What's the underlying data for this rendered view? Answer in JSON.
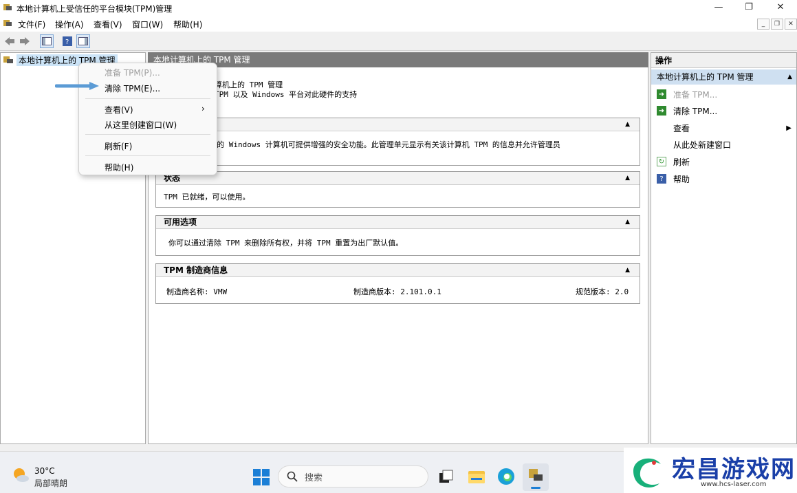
{
  "window": {
    "title": "本地计算机上受信任的平台模块(TPM)管理",
    "minimize": "—",
    "maximize": "❐",
    "close": "✕"
  },
  "menu": [
    "文件(F)",
    "操作(A)",
    "查看(V)",
    "窗口(W)",
    "帮助(H)"
  ],
  "tree": {
    "root_label": "本地计算机上的 TPM 管理"
  },
  "center": {
    "header": "本地计算机上的 TPM 管理",
    "desc_line1": "算机上的 TPM 管理",
    "desc_line2": "TPM 以及 Windows 平台对此硬件的支持",
    "overview_text": "平台模块(TPM)的 Windows 计算机可提供增强的安全功能。此管理单元显示有关该计算机 TPM 的信息并允许管理员",
    "status_title": "状态",
    "status_text": "TPM 已就绪，可以使用。",
    "options_title": "可用选项",
    "options_text": "你可以通过清除 TPM 来删除所有权，并将 TPM 重置为出厂默认值。",
    "mfr_title": "TPM 制造商信息",
    "mfr_name": "制造商名称: VMW",
    "mfr_version": "制造商版本: 2.101.0.1",
    "spec_version": "规范版本: 2.0"
  },
  "actions": {
    "title": "操作",
    "subtitle": "本地计算机上的 TPM 管理",
    "items": [
      "准备 TPM...",
      "清除 TPM...",
      "查看",
      "从此处新建窗口",
      "刷新",
      "帮助"
    ]
  },
  "context_menu": {
    "prepare": "准备 TPM(P)...",
    "clear": "清除 TPM(E)...",
    "view": "查看(V)",
    "new_window": "从这里创建窗口(W)",
    "refresh": "刷新(F)",
    "help": "帮助(H)"
  },
  "taskbar": {
    "temp": "30°C",
    "weather": "局部晴朗",
    "search_placeholder": "搜索"
  },
  "watermark": {
    "name": "宏昌游戏网",
    "url": "www.hcs-laser.com"
  },
  "colors": {
    "accent": "#cfe0f1",
    "header": "#7a7a7a",
    "arrow": "#5b9bd5"
  }
}
